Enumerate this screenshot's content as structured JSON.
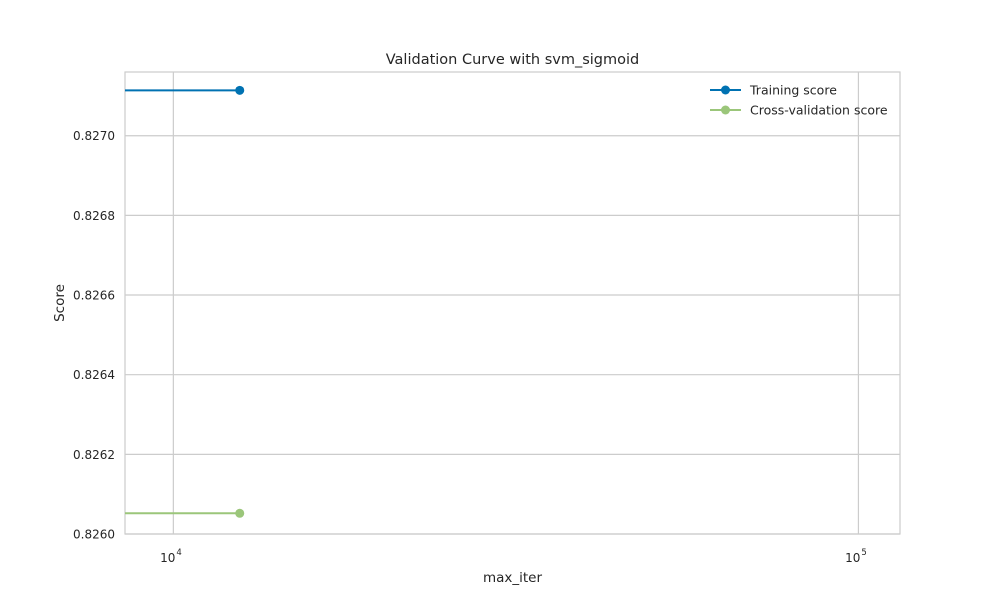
{
  "chart_data": {
    "type": "line",
    "title": "Validation Curve with svm_sigmoid",
    "xlabel": "max_iter",
    "ylabel": "Score",
    "xscale": "log",
    "xlim": [
      8500,
      115000
    ],
    "ylim": [
      0.826,
      0.82716
    ],
    "grid": true,
    "legend_position": "top-right",
    "x_ticks": [
      {
        "value": 10000,
        "base": "10",
        "exp": "4"
      },
      {
        "value": 100000,
        "base": "10",
        "exp": "5"
      }
    ],
    "y_ticks": [
      {
        "value": 0.826,
        "label": "0.8260"
      },
      {
        "value": 0.8262,
        "label": "0.8262"
      },
      {
        "value": 0.8264,
        "label": "0.8264"
      },
      {
        "value": 0.8266,
        "label": "0.8266"
      },
      {
        "value": 0.8268,
        "label": "0.8268"
      },
      {
        "value": 0.827,
        "label": "0.8270"
      }
    ],
    "series": [
      {
        "name": "Training score",
        "color": "#0072B2",
        "points": [
          {
            "x": 1000,
            "y": 0.827114
          },
          {
            "x": 12500,
            "y": 0.827114
          }
        ]
      },
      {
        "name": "Cross-validation score",
        "color": "#9BC67A",
        "points": [
          {
            "x": 1000,
            "y": 0.826052
          },
          {
            "x": 12500,
            "y": 0.826052
          }
        ]
      }
    ]
  }
}
